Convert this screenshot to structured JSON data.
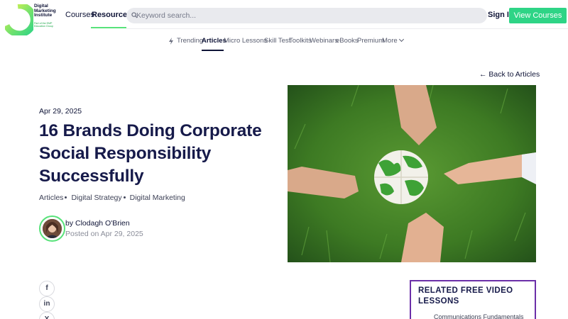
{
  "header": {
    "logo_lines": [
      "Digital",
      "Marketing",
      "Institute"
    ],
    "logo_sub": "Part of the EMP Education Group",
    "nav": {
      "courses": "Courses",
      "resources": "Resources"
    },
    "search": {
      "placeholder": "Keyword search..."
    },
    "sign_in": "Sign In",
    "cta": "View Courses",
    "colors": {
      "accent_green": "#58e27a",
      "cta_green": "#2ed486",
      "navy": "#0f1437"
    }
  },
  "subnav": {
    "items": [
      "Trending",
      "Articles",
      "Micro Lessons",
      "Skill Test",
      "Toolkits",
      "Webinars",
      "eBooks",
      "Premium",
      "More"
    ],
    "active": "Articles",
    "icons": {
      "trending": "lightning-icon",
      "more": "chevron-down-icon"
    }
  },
  "back_link": "← Back to Articles",
  "article": {
    "date": "Apr 29, 2025",
    "title": "16 Brands Doing Corporate Social Responsibility Successfully",
    "tags": [
      "Articles",
      "Digital Strategy",
      "Digital Marketing"
    ],
    "author": "by Clodagh O'Brien",
    "posted": "Posted on Apr 29, 2025"
  },
  "share": {
    "icons": [
      "facebook-icon",
      "linkedin-icon",
      "x-icon"
    ],
    "glyphs": [
      "f",
      "in",
      "X"
    ]
  },
  "related": {
    "title": "RELATED FREE VIDEO LESSONS",
    "items": [
      "Communications Fundamentals"
    ],
    "border_color": "#6b2fa8"
  }
}
